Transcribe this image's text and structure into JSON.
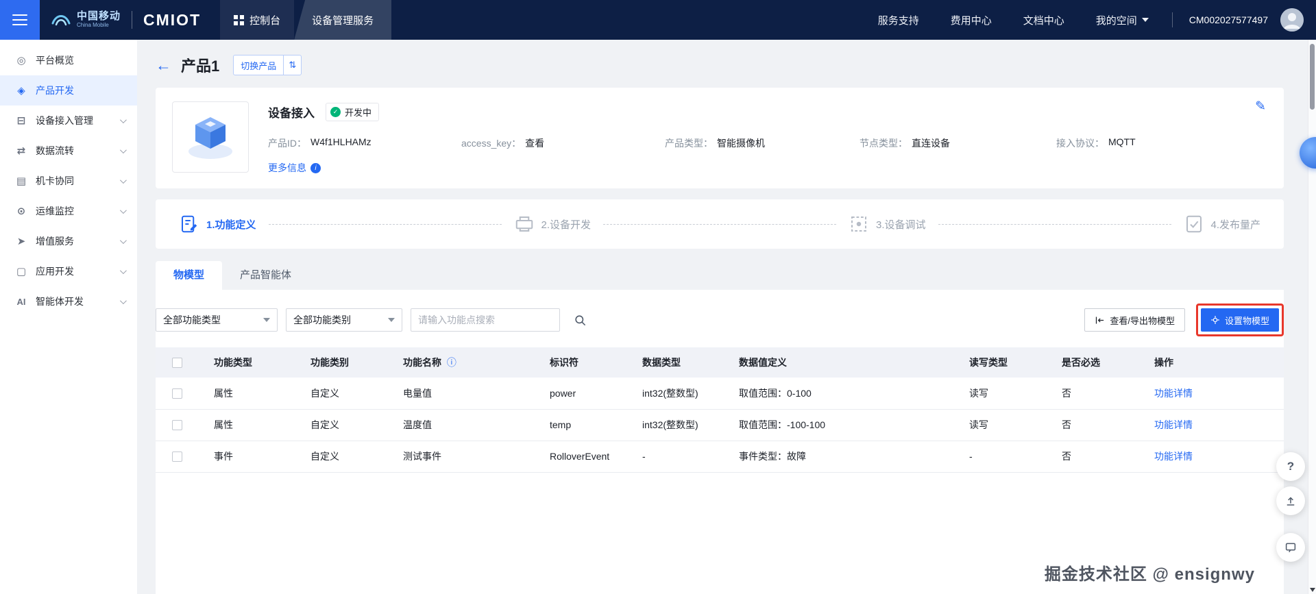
{
  "topbar": {
    "brand_cn": "中国移动",
    "brand_en": "China Mobile",
    "logo_text": "CMIOT",
    "console": "控制台",
    "service": "设备管理服务",
    "nav": [
      "服务支持",
      "费用中心",
      "文档中心",
      "我的空间"
    ],
    "account_id": "CM002027577497"
  },
  "sidebar": {
    "items": [
      {
        "label": "平台概览",
        "glyph": "◎"
      },
      {
        "label": "产品开发",
        "glyph": "◈"
      },
      {
        "label": "设备接入管理",
        "glyph": "⊟"
      },
      {
        "label": "数据流转",
        "glyph": "⇄"
      },
      {
        "label": "机卡协同",
        "glyph": "▤"
      },
      {
        "label": "运维监控",
        "glyph": "⊙"
      },
      {
        "label": "增值服务",
        "glyph": "➤"
      },
      {
        "label": "应用开发",
        "glyph": "▢"
      },
      {
        "label": "智能体开发",
        "glyph": "AI"
      }
    ]
  },
  "page": {
    "back_glyph": "←",
    "title": "产品1",
    "switch_product": "切换产品",
    "switch_glyph": "⇅"
  },
  "product": {
    "name": "设备接入",
    "status": "开发中",
    "status_glyph": "✓",
    "fields": [
      {
        "label": "产品ID：",
        "value": "W4f1HLHAMz"
      },
      {
        "label": "access_key：",
        "value": "查看"
      },
      {
        "label": "产品类型：",
        "value": "智能摄像机"
      },
      {
        "label": "节点类型：",
        "value": "直连设备"
      },
      {
        "label": "接入协议：",
        "value": "MQTT"
      }
    ],
    "more_info": "更多信息",
    "more_info_glyph": "i",
    "edit_glyph": "✎"
  },
  "steps": [
    {
      "label": "1.功能定义"
    },
    {
      "label": "2.设备开发"
    },
    {
      "label": "3.设备调试"
    },
    {
      "label": "4.发布量产"
    }
  ],
  "tabs": [
    {
      "label": "物模型"
    },
    {
      "label": "产品智能体"
    }
  ],
  "filters": {
    "type_dropdown": "全部功能类型",
    "category_dropdown": "全部功能类别",
    "search_placeholder": "请输入功能点搜索"
  },
  "actions": {
    "export_model": "查看/导出物模型",
    "set_model": "设置物模型"
  },
  "table": {
    "name_info_glyph": "ⓘ",
    "headers": [
      "功能类型",
      "功能类别",
      "功能名称",
      "标识符",
      "数据类型",
      "数据值定义",
      "读写类型",
      "是否必选",
      "操作"
    ],
    "rows": [
      {
        "cells": [
          "属性",
          "自定义",
          "电量值",
          "power",
          "int32(整数型)",
          "取值范围：0-100",
          "读写",
          "否"
        ],
        "action": "功能详情"
      },
      {
        "cells": [
          "属性",
          "自定义",
          "温度值",
          "temp",
          "int32(整数型)",
          "取值范围：-100-100",
          "读写",
          "否"
        ],
        "action": "功能详情"
      },
      {
        "cells": [
          "事件",
          "自定义",
          "测试事件",
          "RolloverEvent",
          "-",
          "事件类型：故障",
          "-",
          "否"
        ],
        "action": "功能详情"
      }
    ]
  },
  "fab": {
    "help_glyph": "?"
  },
  "watermark": "掘金技术社区 @ ensignwy",
  "colors": {
    "primary": "#2468f2",
    "topbar_bg": "#0d1f45",
    "success": "#00b578",
    "highlight_red": "#e8372b"
  }
}
